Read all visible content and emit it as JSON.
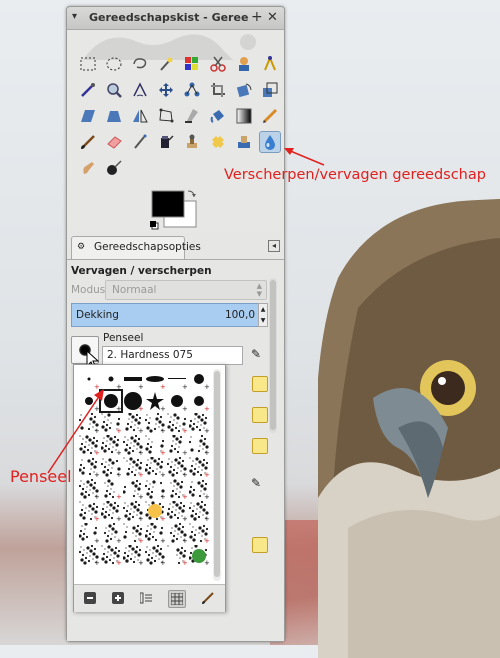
{
  "window": {
    "title": "Gereedschapskist - Gereedscha",
    "menu_icon": "menu-triangle-icon",
    "add_icon": "plus-icon",
    "close_icon": "close-icon"
  },
  "tabs": [
    {
      "label": "Gereedschapsopties"
    }
  ],
  "tool_options": {
    "title": "Vervagen / verscherpen",
    "mode_label": "Modus:",
    "mode_value": "Normaal",
    "opacity_label": "Dekking",
    "opacity_value": "100,0",
    "brush_label": "Penseel",
    "brush_name": "2. Hardness 075"
  },
  "annotations": {
    "tool_callout": "Verscherpen/vervagen gereedschap",
    "brush_callout": "Penseel"
  },
  "colors": {
    "annotation": "#e0211f",
    "active_tool": "#bcd2e8",
    "opacity_fill": "#a9cdf0"
  }
}
